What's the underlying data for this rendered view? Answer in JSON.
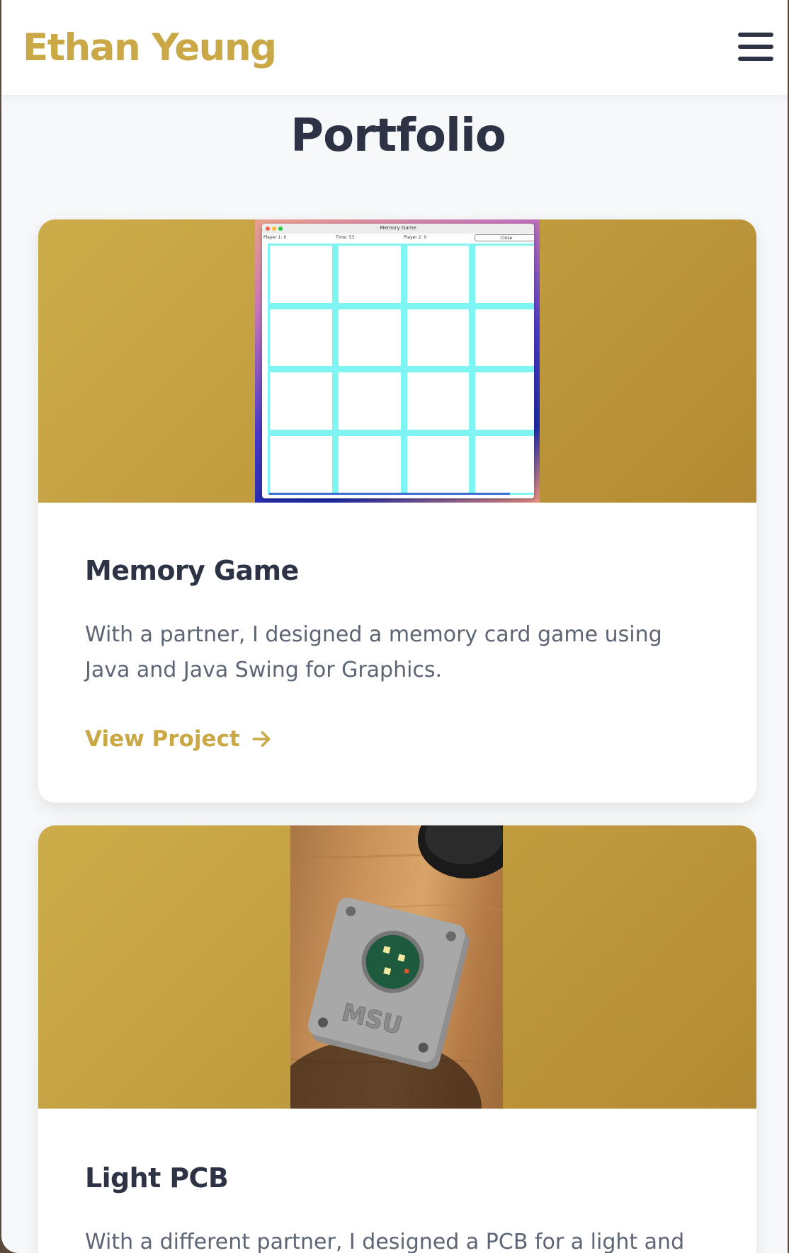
{
  "header": {
    "brand": "Ethan Yeung",
    "menu_icon": "hamburger-menu-icon"
  },
  "page": {
    "title": "Portfolio"
  },
  "projects": [
    {
      "title": "Memory Game",
      "description": "With a partner, I designed a memory card game using Java and Java Swing for Graphics.",
      "link_label": "View Project",
      "link_icon": "arrow-right-icon",
      "screenshot": {
        "window_title": "Memory Game",
        "player1": "Player 1: 0",
        "time": "Time: 53",
        "player2": "Player 2: 0",
        "close_label": "Close"
      }
    },
    {
      "title": "Light PCB",
      "description": "With a different partner, I designed a PCB for a light and also",
      "photo_text": "MSU"
    }
  ],
  "colors": {
    "accent": "#c9a845",
    "heading": "#2d3344",
    "body_text": "#5d6574",
    "card_media_from": "#cdad4a",
    "card_media_to": "#b38a33",
    "tile_border": "#7ef5f2"
  }
}
